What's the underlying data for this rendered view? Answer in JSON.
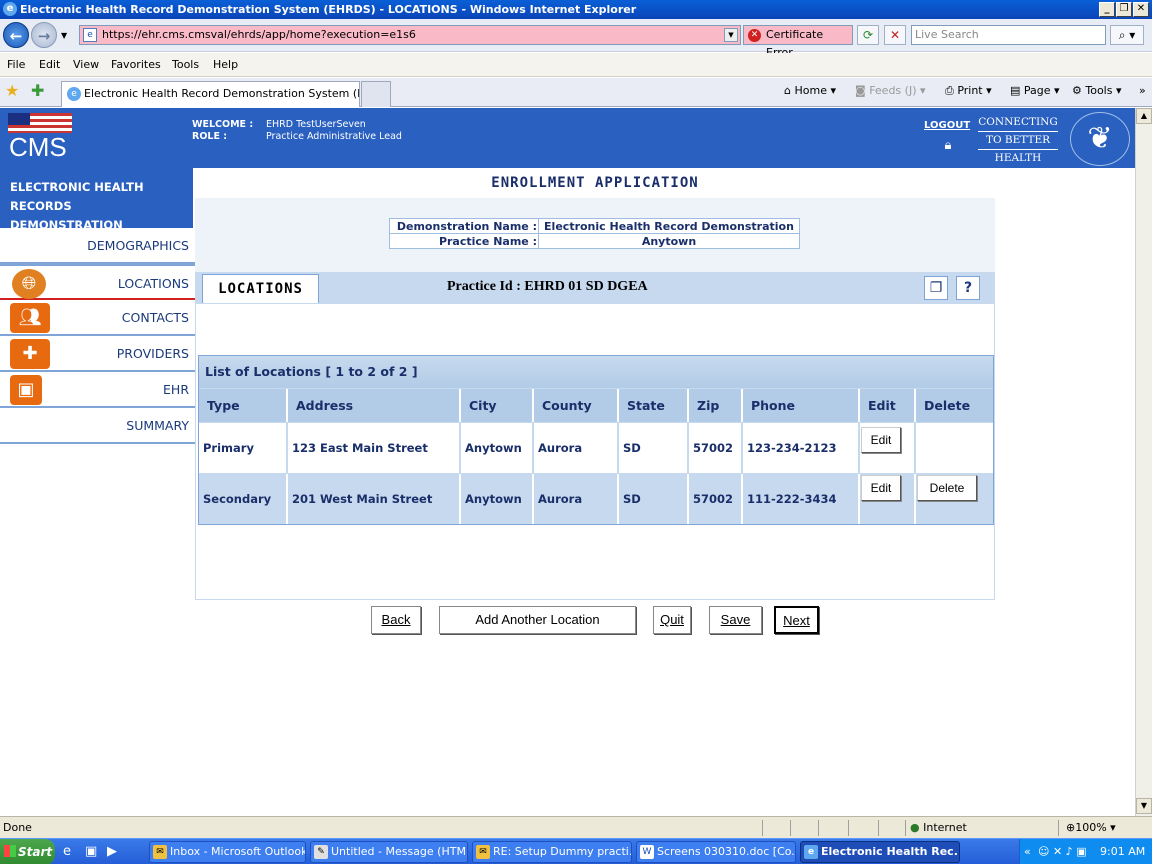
{
  "window": {
    "title": "Electronic Health Record Demonstration System (EHRDS) - LOCATIONS - Windows Internet Explorer"
  },
  "browser": {
    "url": "https://ehr.cms.cmsval/ehrds/app/home?execution=e1s6",
    "cert_error": "Certificate Error",
    "search_placeholder": "Live Search",
    "menu": [
      "File",
      "Edit",
      "View",
      "Favorites",
      "Tools",
      "Help"
    ],
    "tab_title": "Electronic Health Record Demonstration System (EHR...",
    "commands": {
      "home": "Home",
      "feeds": "Feeds (J)",
      "print": "Print",
      "page": "Page",
      "tools": "Tools"
    }
  },
  "header": {
    "logo": "CMS",
    "welcome_label": "WELCOME :",
    "welcome_value": "EHRD TestUserSeven",
    "role_label": "ROLE :",
    "role_value": "Practice Administrative Lead",
    "logout": "LOGOUT",
    "connecting": [
      "CONNECTING",
      "TO BETTER",
      "HEALTH CARE"
    ]
  },
  "sidebar": {
    "title_line1": "ELECTRONIC HEALTH RECORDS",
    "title_line2": "DEMONSTRATION",
    "items": [
      {
        "label": "DEMOGRAPHICS"
      },
      {
        "label": "LOCATIONS"
      },
      {
        "label": "CONTACTS"
      },
      {
        "label": "PROVIDERS"
      },
      {
        "label": "EHR"
      },
      {
        "label": "SUMMARY"
      }
    ]
  },
  "main": {
    "title": "ENROLLMENT APPLICATION",
    "demo_name_label": "Demonstration Name :",
    "demo_name_value": "Electronic Health Record Demonstration",
    "practice_name_label": "Practice Name :",
    "practice_name_value": "Anytown",
    "section_tab": "LOCATIONS",
    "practice_id": "Practice Id : EHRD 01 SD DGEA",
    "list_title": "List of Locations [ 1 to 2 of 2 ]",
    "columns": [
      "Type",
      "Address",
      "City",
      "County",
      "State",
      "Zip",
      "Phone",
      "Edit",
      "Delete"
    ],
    "rows": [
      {
        "type": "Primary",
        "address": "123 East Main Street",
        "city": "Anytown",
        "county": "Aurora",
        "state": "SD",
        "zip": "57002",
        "phone": "123-234-2123",
        "edit": "Edit"
      },
      {
        "type": "Secondary",
        "address": "201 West Main Street",
        "city": "Anytown",
        "county": "Aurora",
        "state": "SD",
        "zip": "57002",
        "phone": "111-222-3434",
        "edit": "Edit",
        "delete": "Delete"
      }
    ],
    "buttons": {
      "back": "Back",
      "add": "Add Another Location",
      "quit": "Quit",
      "save": "Save",
      "next": "Next"
    }
  },
  "statusbar": {
    "status": "Done",
    "zone": "Internet",
    "zoom": "100%"
  },
  "taskbar": {
    "start": "Start",
    "tasks": [
      "Inbox - Microsoft Outlook",
      "Untitled - Message (HTML)",
      "RE: Setup Dummy practi...",
      "Screens 030310.doc [Co...",
      "Electronic Health Rec..."
    ],
    "clock": "9:01 AM"
  }
}
